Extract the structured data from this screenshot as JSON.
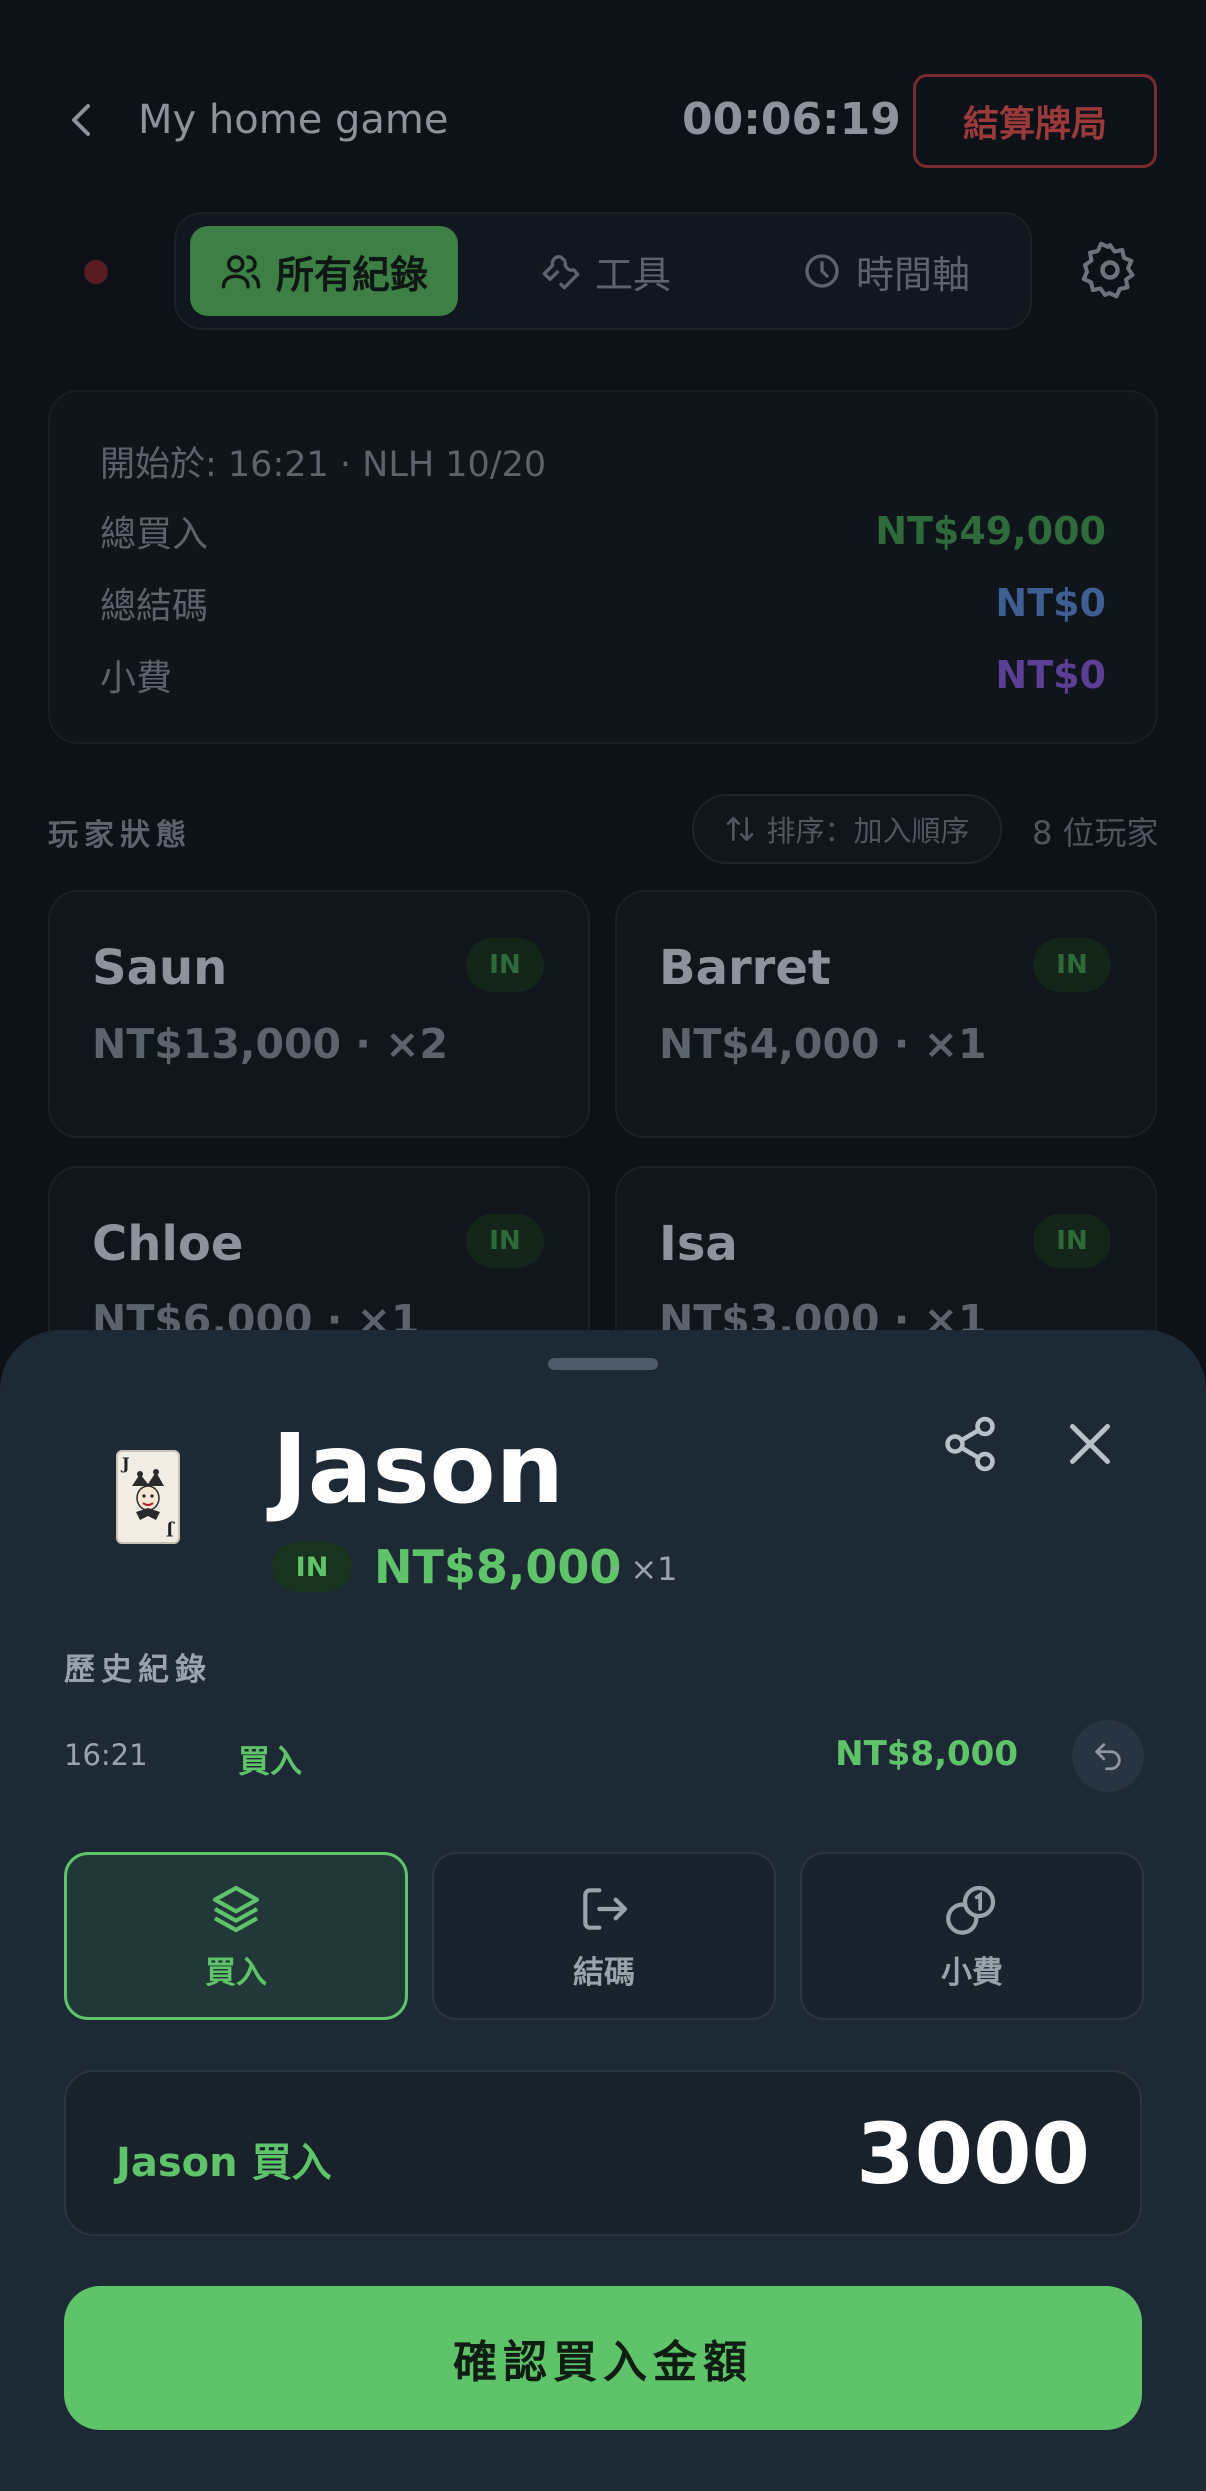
{
  "header": {
    "title": "My home game",
    "timer": "00:06:19",
    "settle_label": "結算牌局"
  },
  "tabs": [
    {
      "label": "所有紀錄",
      "icon": "users-icon",
      "active": true
    },
    {
      "label": "工具",
      "icon": "wrench-icon",
      "active": false
    },
    {
      "label": "時間軸",
      "icon": "clock-icon",
      "active": false
    }
  ],
  "summary": {
    "header": "開始於: 16:21 · NLH 10/20",
    "total_buyin_label": "總買入",
    "total_buyin_value": "NT$49,000",
    "total_cashout_label": "總結碼",
    "total_cashout_value": "NT$0",
    "tips_label": "小費",
    "tips_value": "NT$0"
  },
  "players_section": {
    "title": "玩家狀態",
    "sort_label": "排序：加入順序",
    "count": "8 位玩家"
  },
  "players": [
    {
      "name": "Saun",
      "amount": "NT$13,000 · ×2",
      "status": "IN"
    },
    {
      "name": "Barret",
      "amount": "NT$4,000 · ×1",
      "status": "IN"
    },
    {
      "name": "Chloe",
      "amount": "NT$6,000 · ×1",
      "status": "IN"
    },
    {
      "name": "Isa",
      "amount": "NT$3,000 · ×1",
      "status": "IN"
    }
  ],
  "sheet": {
    "avatar_rank": "J",
    "player_name": "Jason",
    "status": "IN",
    "amount": "NT$8,000",
    "multiplier": "· ×1",
    "history_title": "歷史紀錄",
    "history": [
      {
        "time": "16:21",
        "type": "買入",
        "amount": "NT$8,000"
      }
    ],
    "actions": [
      {
        "label": "買入",
        "icon": "layers-icon",
        "active": true
      },
      {
        "label": "結碼",
        "icon": "logout-icon",
        "active": false
      },
      {
        "label": "小費",
        "icon": "coins-icon",
        "active": false
      }
    ],
    "amount_label": "Jason 買入",
    "amount_value": "3000",
    "confirm_label": "確認買入金額"
  },
  "colors": {
    "accent_green": "#5fc36a",
    "danger_red": "#9a3a3a",
    "cashout_blue": "#3f5f93",
    "tips_purple": "#5b3f94"
  }
}
